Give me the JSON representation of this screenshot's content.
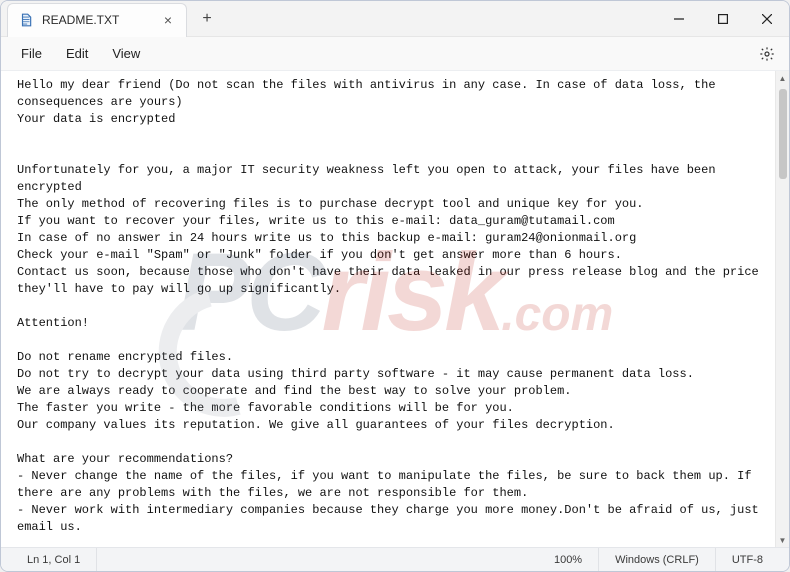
{
  "window": {
    "tab_title": "README.TXT",
    "tab_close_glyph": "×",
    "newtab_glyph": "+"
  },
  "menu": {
    "file": "File",
    "edit": "Edit",
    "view": "View"
  },
  "body_text": "Hello my dear friend (Do not scan the files with antivirus in any case. In case of data loss, the consequences are yours)\nYour data is encrypted\n\n\nUnfortunately for you, a major IT security weakness left you open to attack, your files have been encrypted\nThe only method of recovering files is to purchase decrypt tool and unique key for you.\nIf you want to recover your files, write us to this e-mail: data_guram@tutamail.com\nIn case of no answer in 24 hours write us to this backup e-mail: guram24@onionmail.org\nCheck your e-mail \"Spam\" or \"Junk\" folder if you don't get answer more than 6 hours.\nContact us soon, because those who don't have their data leaked in our press release blog and the price they'll have to pay will go up significantly.\n\nAttention!\n\nDo not rename encrypted files.\nDo not try to decrypt your data using third party software - it may cause permanent data loss.\nWe are always ready to cooperate and find the best way to solve your problem.\nThe faster you write - the more favorable conditions will be for you.\nOur company values its reputation. We give all guarantees of your files decryption.\n\nWhat are your recommendations?\n- Never change the name of the files, if you want to manipulate the files, be sure to back them up. If there are any problems with the files, we are not responsible for them.\n- Never work with intermediary companies because they charge you more money.Don't be afraid of us, just email us.\n\n\nSensitive data on your system was DOWNLOADED.\nIf you DON'T WANT your sensitive data to be PUBLISHED you have to act quickly.\n\nData includes:\n- Employees personal data, CVs, DL, SSN.\n- Complete network map including credentials for local and remote services.",
  "status": {
    "position": "Ln 1, Col 1",
    "zoom": "100%",
    "line_ending": "Windows (CRLF)",
    "encoding": "UTF-8"
  },
  "watermark": {
    "prefix": "PC",
    "mid": "risk",
    "suffix": ".com"
  }
}
